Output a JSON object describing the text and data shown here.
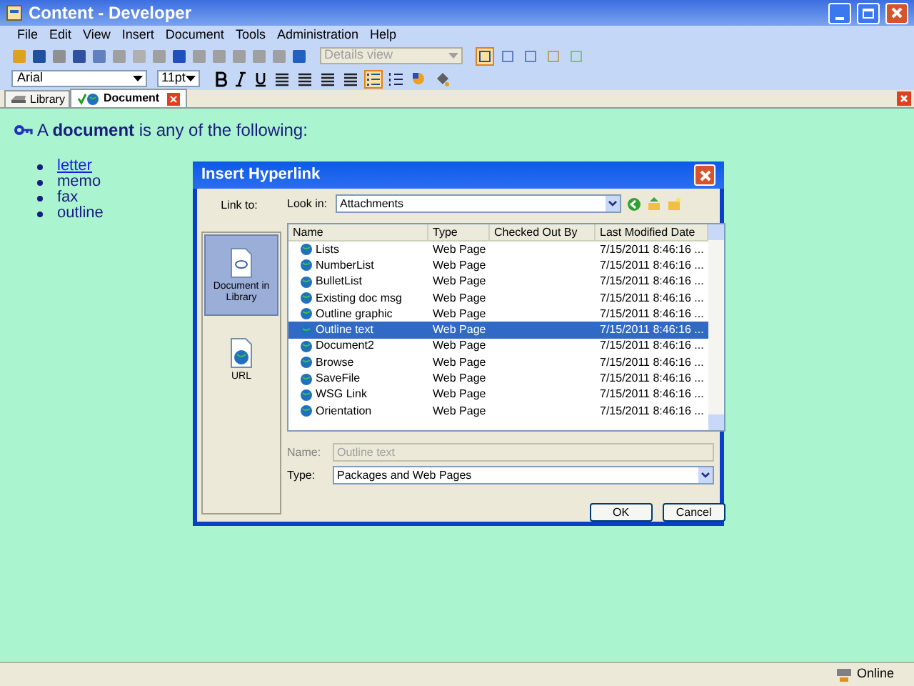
{
  "window": {
    "title": "Content - Developer"
  },
  "menu": [
    "File",
    "Edit",
    "View",
    "Insert",
    "Document",
    "Tools",
    "Administration",
    "Help"
  ],
  "toolbar": {
    "view_combo": {
      "value": "Details view",
      "disabled": true
    },
    "font": "Arial",
    "size": "11pt"
  },
  "tabs": [
    {
      "label": "Library",
      "selected": false
    },
    {
      "label": "Document",
      "selected": true
    }
  ],
  "content": {
    "heading": "A **document** is any of the following:",
    "items": [
      {
        "text": "letter",
        "link": true
      },
      {
        "text": "memo",
        "link": false
      },
      {
        "text": "fax",
        "link": false
      },
      {
        "text": "outline",
        "link": false
      }
    ]
  },
  "dialog": {
    "title": "Insert Hyperlink",
    "link_to": "Link to:",
    "nav": [
      {
        "label": "Document in Library",
        "selected": true
      },
      {
        "label": "URL",
        "selected": false
      }
    ],
    "look_in": {
      "label": "Look in:",
      "value": "Attachments"
    },
    "columns": [
      "Name",
      "Type",
      "Checked Out By",
      "Last Modified Date"
    ],
    "rows": [
      {
        "name": "Lists",
        "type": "Web Page",
        "checked_out_by": "",
        "date": "7/15/2011 8:46:16 ...",
        "selected": false
      },
      {
        "name": "NumberList",
        "type": "Web Page",
        "checked_out_by": "",
        "date": "7/15/2011 8:46:16 ...",
        "selected": false
      },
      {
        "name": "BulletList",
        "type": "Web Page",
        "checked_out_by": "",
        "date": "7/15/2011 8:46:16 ...",
        "selected": false
      },
      {
        "name": "Existing doc msg",
        "type": "Web Page",
        "checked_out_by": "",
        "date": "7/15/2011 8:46:16 ...",
        "selected": false
      },
      {
        "name": "Outline graphic",
        "type": "Web Page",
        "checked_out_by": "",
        "date": "7/15/2011 8:46:16 ...",
        "selected": false
      },
      {
        "name": "Outline text",
        "type": "Web Page",
        "checked_out_by": "",
        "date": "7/15/2011 8:46:16 ...",
        "selected": true
      },
      {
        "name": "Document2",
        "type": "Web Page",
        "checked_out_by": "",
        "date": "7/15/2011 8:46:16 ...",
        "selected": false
      },
      {
        "name": "Browse",
        "type": "Web Page",
        "checked_out_by": "",
        "date": "7/15/2011 8:46:16 ...",
        "selected": false
      },
      {
        "name": "SaveFile",
        "type": "Web Page",
        "checked_out_by": "",
        "date": "7/15/2011 8:46:16 ...",
        "selected": false
      },
      {
        "name": "WSG Link",
        "type": "Web Page",
        "checked_out_by": "",
        "date": "7/15/2011 8:46:16 ...",
        "selected": false
      },
      {
        "name": "Orientation",
        "type": "Web Page",
        "checked_out_by": "",
        "date": "7/15/2011 8:46:16 ...",
        "selected": false
      }
    ],
    "name_field": {
      "label": "Name:",
      "value": "Outline text",
      "disabled": true
    },
    "type_field": {
      "label": "Type:",
      "value": "Packages and Web Pages"
    },
    "buttons": [
      "OK",
      "Cancel"
    ]
  },
  "status_bar": {
    "status": "Online"
  }
}
